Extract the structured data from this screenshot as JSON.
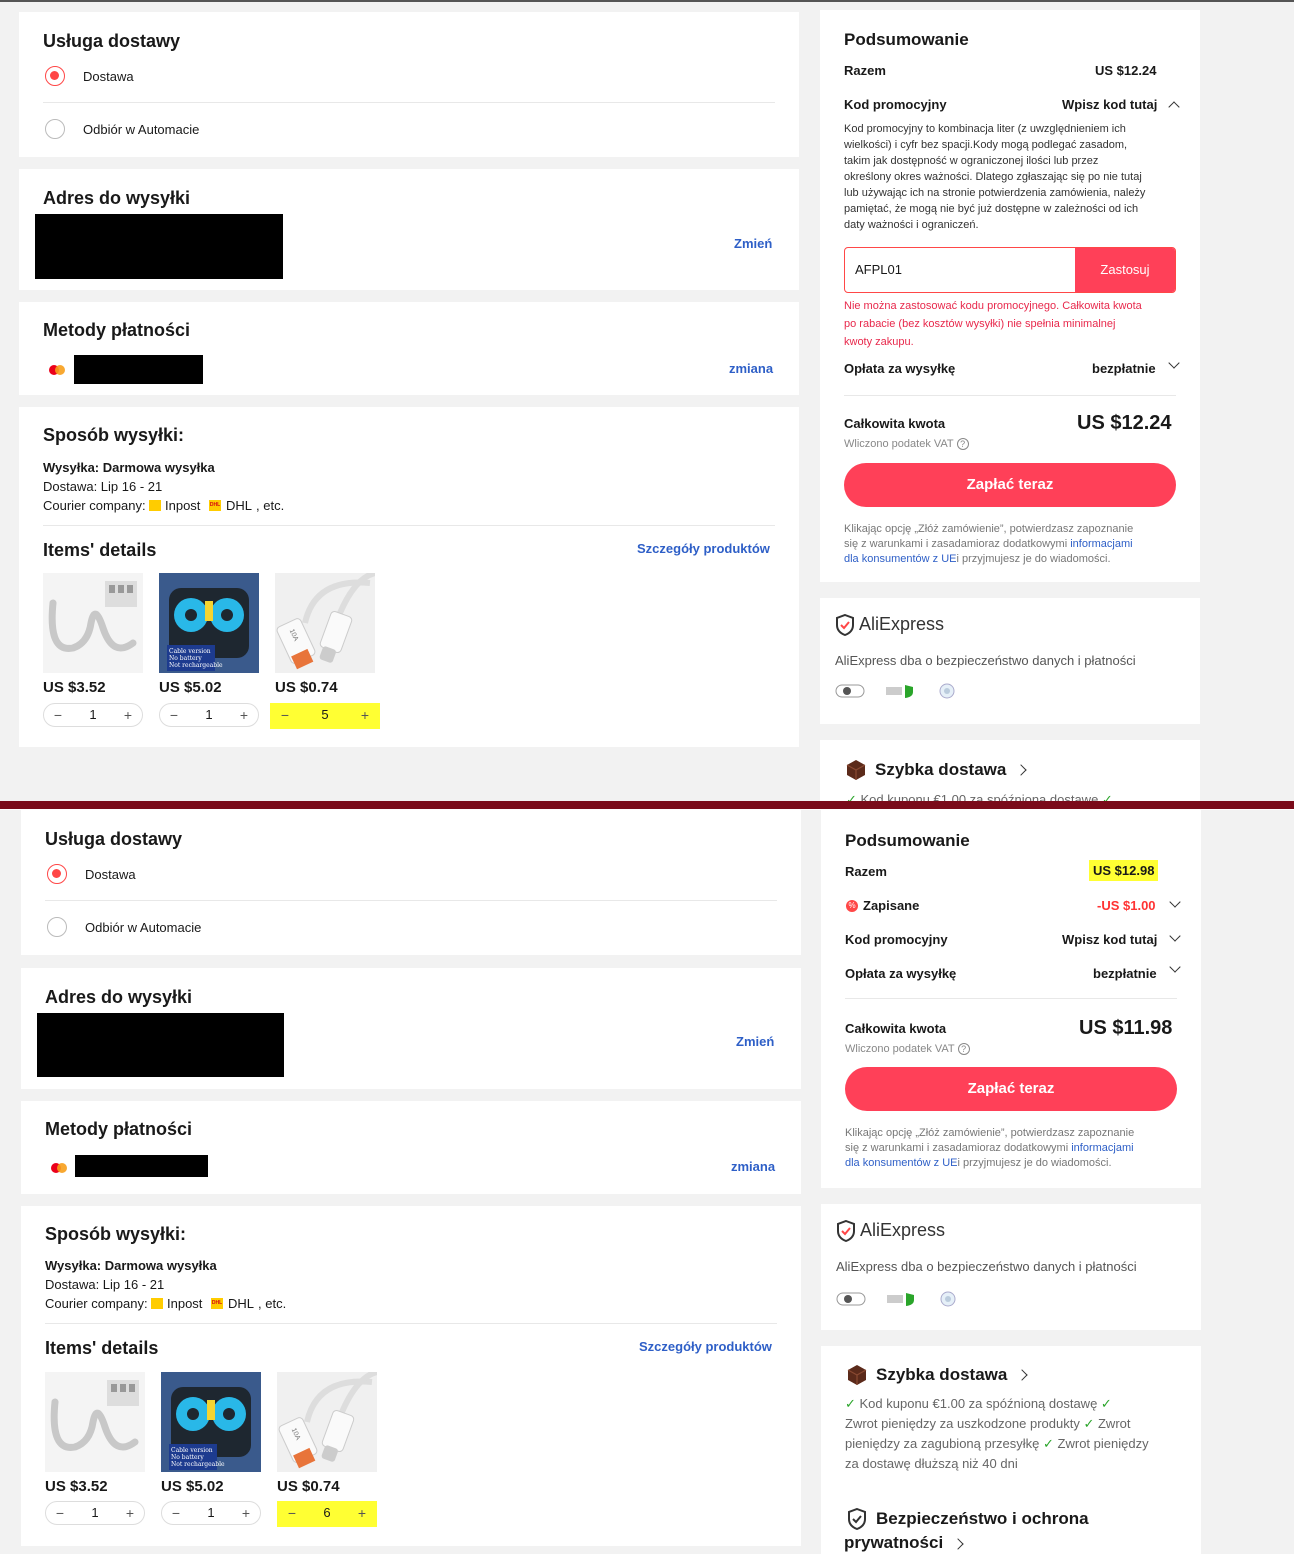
{
  "delivery": {
    "title": "Usługa dostawy",
    "option1": "Dostawa",
    "option2": "Odbiór w Automacie"
  },
  "address": {
    "title": "Adres do wysyłki",
    "change": "Zmień"
  },
  "payment": {
    "title": "Metody płatności",
    "change": "zmiana"
  },
  "shipping": {
    "title": "Sposób wysyłki:",
    "method": "Wysyłka: Darmowa wysyłka",
    "delivery": "Dostawa: Lip 16 - 21",
    "courier_label": "Courier company:",
    "courier1": "Inpost",
    "courier2": "DHL",
    "courier_etc": ", etc."
  },
  "items": {
    "title": "Items' details",
    "link": "Szczegóły produktów",
    "prices": [
      "US $3.52",
      "US $5.02",
      "US $0.74"
    ],
    "qty_a": [
      "1",
      "1",
      "5"
    ],
    "qty_b": [
      "1",
      "1",
      "6"
    ],
    "thumb_texts": [
      "Cable version",
      "No battery",
      "Not rechargeable"
    ],
    "cable_label": "10A"
  },
  "summary": {
    "title": "Podsumowanie",
    "subtotal_label": "Razem",
    "subtotal_a": "US $12.24",
    "subtotal_b": "US $12.98",
    "saved_label": "Zapisane",
    "saved_value": "-US $1.00",
    "promo_label": "Kod promocyjny",
    "promo_action": "Wpisz kod tutaj",
    "promo_desc": [
      "Kod promocyjny to kombinacja liter (z uwzględnieniem ich",
      "wielkości) i cyfr bez spacji.Kody mogą podlegać zasadom,",
      "takim jak dostępność w ograniczonej ilości lub przez",
      "określony okres ważności. Dlatego zgłaszając się po nie tutaj",
      "lub używając ich na stronie potwierdzenia zamówienia, należy",
      "pamiętać, że mogą nie być już dostępne w zależności od ich",
      "daty ważności i ograniczeń."
    ],
    "promo_input": "AFPL01",
    "promo_apply": "Zastosuj",
    "promo_error": [
      "Nie można zastosować kodu promocyjnego. Całkowita kwota",
      "po rabacie (bez kosztów wysyłki) nie spełnia minimalnej",
      "kwoty zakupu."
    ],
    "shipping_label": "Opłata za wysyłkę",
    "shipping_value": "bezpłatnie",
    "total_label": "Całkowita kwota",
    "total_a": "US $12.24",
    "total_b": "US $11.98",
    "vat": "Wliczono podatek VAT",
    "pay": "Zapłać teraz",
    "legal1": "Klikając opcję „Złóż zamówienie”, potwierdzasz zapoznanie",
    "legal2a": "się z warunkami i zasadamioraz dodatkowymi ",
    "legal2b": "informacjami",
    "legal3a": "dla konsumentów z UE",
    "legal3b": "i przyjmujesz je do wiadomości."
  },
  "trust": {
    "logo": "AliExpress",
    "subtitle": "AliExpress dba o bezpieczeństwo danych i płatności"
  },
  "fast": {
    "title": "Szybka dostawa",
    "perk1": "Kod kuponu €1.00 za spóźnioną dostawę",
    "perk2": "Zwrot pieniędzy za uszkodzone produkty",
    "perk3a": "Zwrot",
    "perk3b": "pieniędzy za zagubioną przesyłkę",
    "perk4a": "Zwrot pieniędzy",
    "perk5": "za dostawę dłuższą niż 40 dni"
  },
  "security": {
    "title1": "Bezpieczeństwo i ochrona",
    "title2": "prywatności"
  },
  "colors": {
    "accent": "#ff4058",
    "link": "#2e5fc7",
    "highlight": "#ffff33",
    "divider": "#7a0b1a"
  }
}
